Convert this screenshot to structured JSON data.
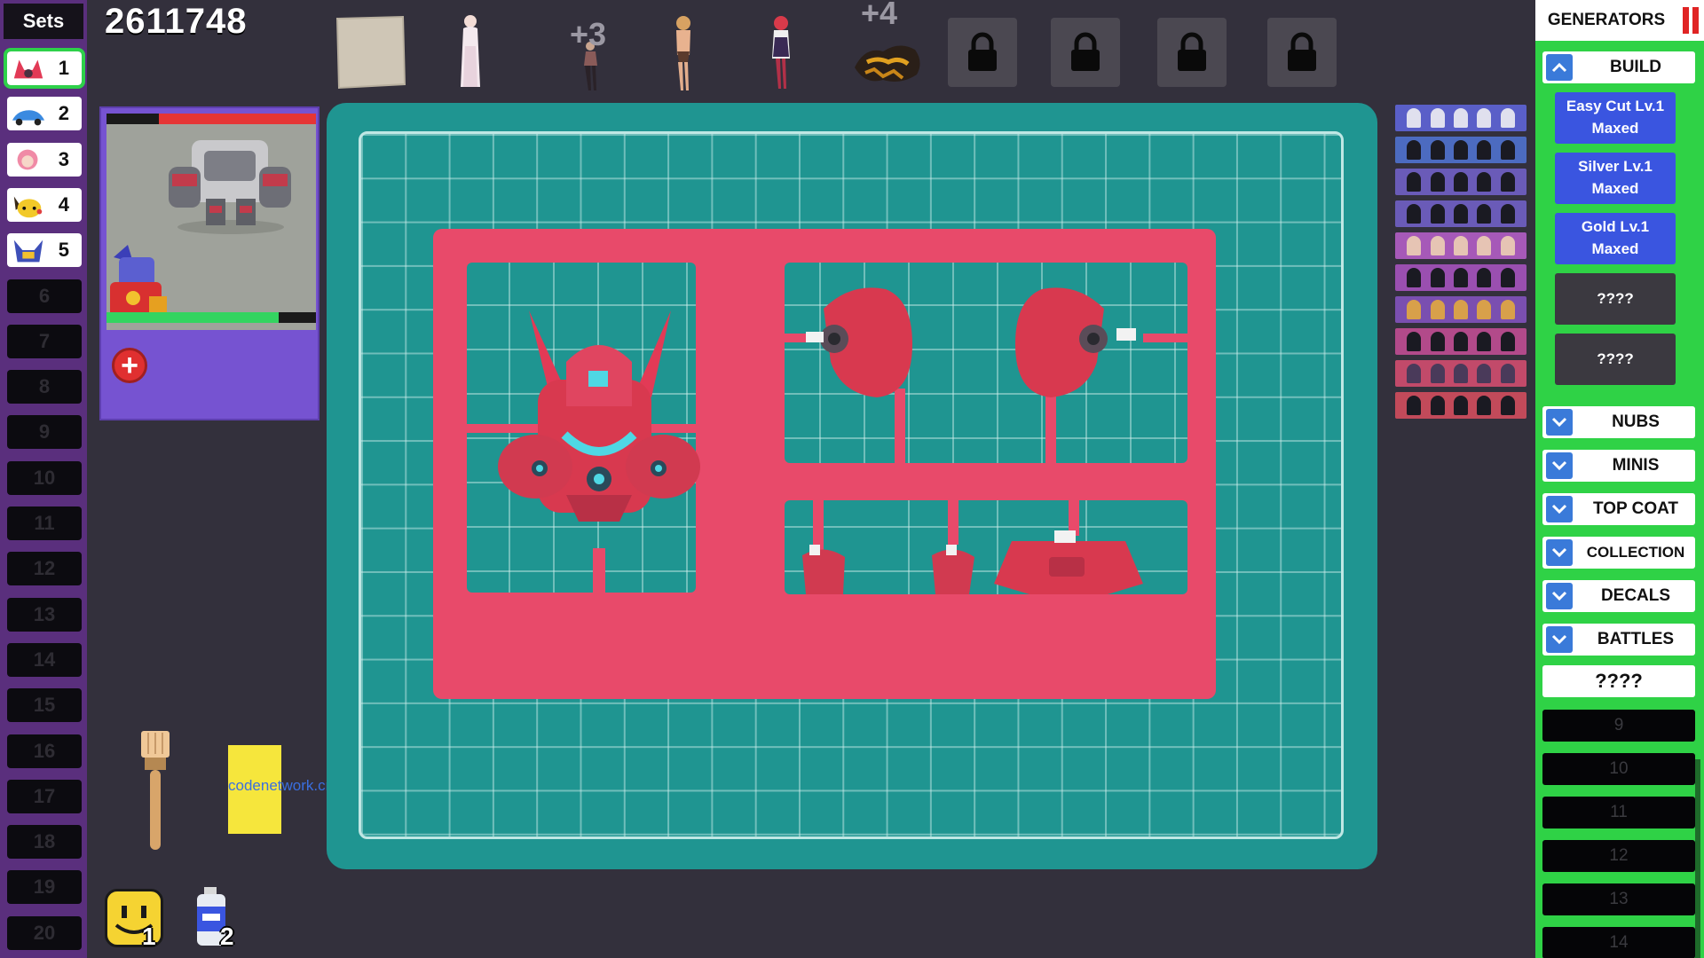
{
  "sets": {
    "title": "Sets",
    "items": [
      {
        "num": "1",
        "unlocked": true,
        "active": true,
        "thumb": "red-mech-thumb"
      },
      {
        "num": "2",
        "unlocked": true,
        "active": false,
        "thumb": "blue-car-thumb"
      },
      {
        "num": "3",
        "unlocked": true,
        "active": false,
        "thumb": "pink-girl-thumb"
      },
      {
        "num": "4",
        "unlocked": true,
        "active": false,
        "thumb": "pikachu-thumb"
      },
      {
        "num": "5",
        "unlocked": true,
        "active": false,
        "thumb": "blue-robot-thumb"
      },
      {
        "num": "6",
        "unlocked": false
      },
      {
        "num": "7",
        "unlocked": false
      },
      {
        "num": "8",
        "unlocked": false
      },
      {
        "num": "9",
        "unlocked": false
      },
      {
        "num": "10",
        "unlocked": false
      },
      {
        "num": "11",
        "unlocked": false
      },
      {
        "num": "12",
        "unlocked": false
      },
      {
        "num": "13",
        "unlocked": false
      },
      {
        "num": "14",
        "unlocked": false
      },
      {
        "num": "15",
        "unlocked": false
      },
      {
        "num": "16",
        "unlocked": false
      },
      {
        "num": "17",
        "unlocked": false
      },
      {
        "num": "18",
        "unlocked": false
      },
      {
        "num": "19",
        "unlocked": false
      },
      {
        "num": "20",
        "unlocked": false
      }
    ]
  },
  "score": "2611748",
  "top_bar": {
    "plus_a": "+3",
    "plus_b": "+4"
  },
  "preview": {
    "top_bar_fill": 0.75,
    "bottom_bar_fill": 0.82,
    "add_label": "+"
  },
  "tools": {
    "watermark": "codenetwork.cn",
    "face_count": "1",
    "spray_count": "2"
  },
  "generators": {
    "title": "GENERATORS",
    "build_label": "BUILD",
    "build_items": [
      {
        "line1": "Easy Cut Lv.1",
        "line2": "Maxed",
        "state": "maxed"
      },
      {
        "line1": "Silver Lv.1",
        "line2": "Maxed",
        "state": "maxed"
      },
      {
        "line1": "Gold Lv.1",
        "line2": "Maxed",
        "state": "maxed"
      },
      {
        "line1": "????",
        "line2": "",
        "state": "locked"
      },
      {
        "line1": "????",
        "line2": "",
        "state": "locked"
      }
    ],
    "categories": [
      "NUBS",
      "MINIS",
      "TOP COAT",
      "COLLECTION",
      "DECALS",
      "BATTLES"
    ],
    "unknown_label": "????",
    "slots": [
      "9",
      "10",
      "11",
      "12",
      "13",
      "14"
    ]
  },
  "colors": {
    "mat": "#1f9591",
    "runner": "#e84a6a",
    "gen_panel": "#2fd246",
    "sets_panel": "#5a2f7d",
    "maxed_blue": "#3a55e0"
  }
}
